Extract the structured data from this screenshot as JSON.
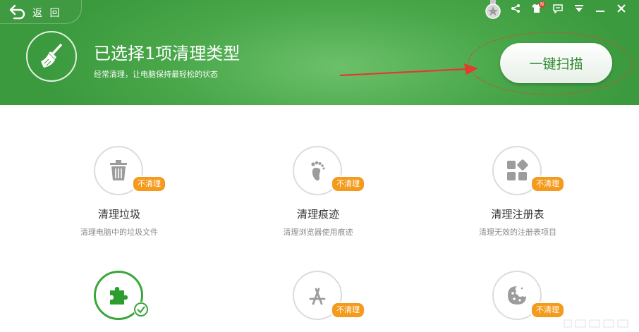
{
  "nav": {
    "back_label": "返 回"
  },
  "header": {
    "title": "已选择1项清理类型",
    "subtitle": "经常清理，让电脑保持最轻松的状态",
    "scan_button": "一键扫描",
    "notification_badge": "N"
  },
  "items": [
    {
      "title": "清理垃圾",
      "desc": "清理电脑中的垃圾文件",
      "badge": "不清理",
      "icon": "trash-icon",
      "selected": false
    },
    {
      "title": "清理痕迹",
      "desc": "清理浏览器使用痕迹",
      "badge": "不清理",
      "icon": "footprint-icon",
      "selected": false
    },
    {
      "title": "清理注册表",
      "desc": "清理无效的注册表项目",
      "badge": "不清理",
      "icon": "registry-icon",
      "selected": false
    },
    {
      "title": "",
      "desc": "",
      "badge": "",
      "icon": "puzzle-icon",
      "selected": true
    },
    {
      "title": "",
      "desc": "",
      "badge": "不清理",
      "icon": "app-store-icon",
      "selected": false
    },
    {
      "title": "",
      "desc": "",
      "badge": "不清理",
      "icon": "cookie-icon",
      "selected": false
    }
  ],
  "colors": {
    "header_green": "#4aa84b",
    "badge_orange": "#f49a1c",
    "active_green": "#38a73a",
    "arrow_red": "#e23b2e"
  }
}
